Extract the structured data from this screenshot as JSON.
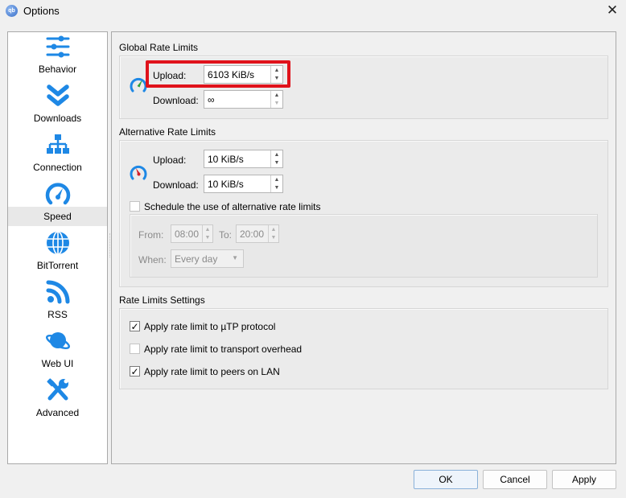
{
  "window": {
    "title": "Options",
    "app_icon": "qbittorrent-logo",
    "app_icon_text": "qb",
    "close_icon": "close-icon",
    "close_glyph": "✕"
  },
  "sidebar": {
    "selected": "Speed",
    "items": [
      {
        "label": "Behavior",
        "icon": "sliders-icon"
      },
      {
        "label": "Downloads",
        "icon": "double-chevron-down-icon"
      },
      {
        "label": "Connection",
        "icon": "network-icon"
      },
      {
        "label": "Speed",
        "icon": "speedometer-icon"
      },
      {
        "label": "BitTorrent",
        "icon": "globe-icon"
      },
      {
        "label": "RSS",
        "icon": "rss-icon"
      },
      {
        "label": "Web UI",
        "icon": "planet-icon"
      },
      {
        "label": "Advanced",
        "icon": "tools-icon"
      }
    ]
  },
  "global_rate_limits": {
    "title": "Global Rate Limits",
    "upload_label": "Upload:",
    "upload_value": "6103 KiB/s",
    "download_label": "Download:",
    "download_value": "∞"
  },
  "alternative_rate_limits": {
    "title": "Alternative Rate Limits",
    "upload_label": "Upload:",
    "upload_value": "10 KiB/s",
    "download_label": "Download:",
    "download_value": "10 KiB/s",
    "schedule_label": "Schedule the use of alternative rate limits",
    "schedule_checked": false,
    "from_label": "From:",
    "from_value": "08:00",
    "to_label": "To:",
    "to_value": "20:00",
    "when_label": "When:",
    "when_value": "Every day"
  },
  "rate_limits_settings": {
    "title": "Rate Limits Settings",
    "options": [
      {
        "label": "Apply rate limit to µTP protocol",
        "checked": true
      },
      {
        "label": "Apply rate limit to transport overhead",
        "checked": false
      },
      {
        "label": "Apply rate limit to peers on LAN",
        "checked": true
      }
    ]
  },
  "glyphs": {
    "check": "✓",
    "up": "▲",
    "down": "▼"
  },
  "buttons": {
    "ok": "OK",
    "cancel": "Cancel",
    "apply": "Apply"
  },
  "colors": {
    "accent_blue": "#1e88e5",
    "highlight_red": "#e0121b",
    "gauge_green": "#2e9e3a",
    "gauge_red": "#d3202a"
  }
}
